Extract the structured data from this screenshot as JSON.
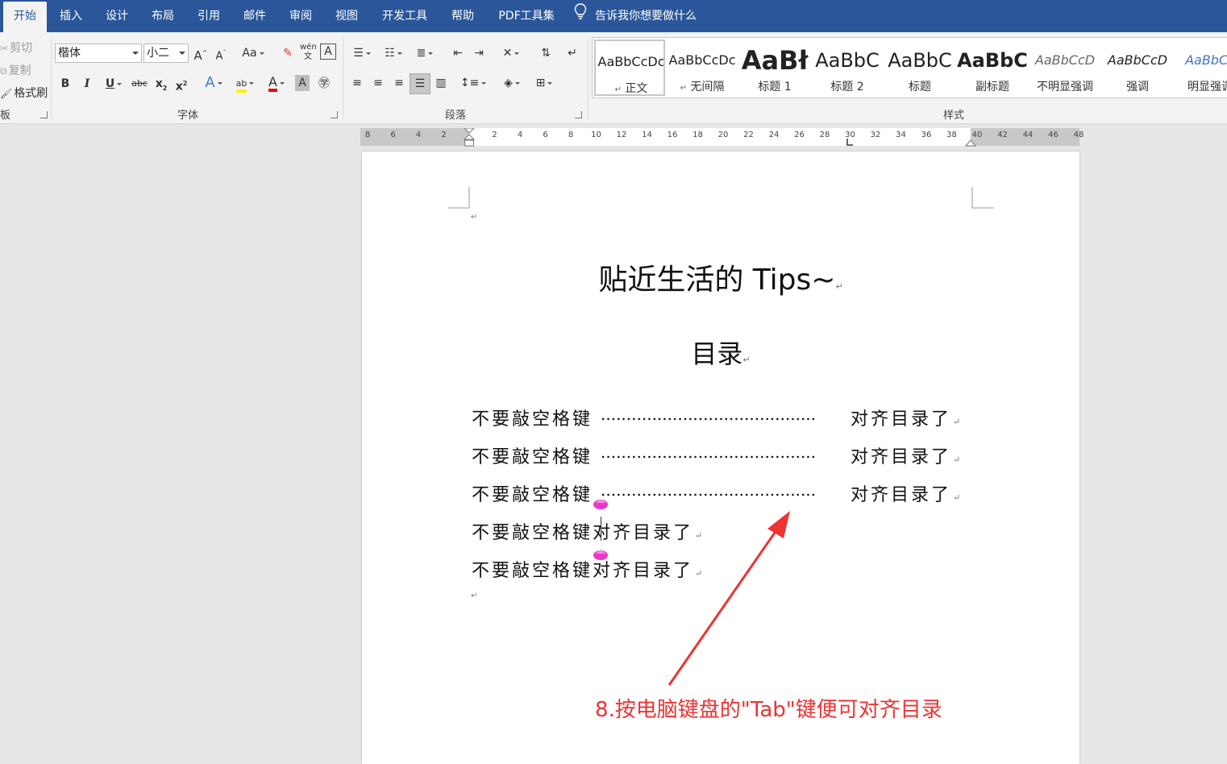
{
  "tabs": [
    {
      "label": "开始",
      "active": true
    },
    {
      "label": "插入"
    },
    {
      "label": "设计"
    },
    {
      "label": "布局"
    },
    {
      "label": "引用"
    },
    {
      "label": "邮件"
    },
    {
      "label": "审阅"
    },
    {
      "label": "视图"
    },
    {
      "label": "开发工具"
    },
    {
      "label": "帮助"
    },
    {
      "label": "PDF工具集"
    }
  ],
  "tell_me": "告诉我你想要做什么",
  "clipboard": {
    "cut": "剪切",
    "copy": "复制",
    "format_painter": "格式刷",
    "group_label": "板"
  },
  "font": {
    "name": "楷体",
    "size": "小二",
    "grow": "A",
    "shrink": "A",
    "change_case": "Aa",
    "bold": "B",
    "italic": "I",
    "underline": "U",
    "strikethrough": "abc",
    "subscript": "x",
    "superscript": "x",
    "group_label": "字体"
  },
  "paragraph": {
    "group_label": "段落"
  },
  "styles": {
    "group_label": "样式",
    "items": [
      {
        "preview": "AaBbCcDc",
        "name": "正文"
      },
      {
        "preview": "AaBbCcDc",
        "name": "无间隔"
      },
      {
        "preview": "AaBł",
        "name": "标题 1"
      },
      {
        "preview": "AaBbC",
        "name": "标题 2"
      },
      {
        "preview": "AaBbC",
        "name": "标题"
      },
      {
        "preview": "AaBbC",
        "name": "副标题"
      },
      {
        "preview": "AaBbCcD",
        "name": "不明显强调"
      },
      {
        "preview": "AaBbCcD",
        "name": "强调"
      },
      {
        "preview": "AaBbCc",
        "name": "明显强调"
      }
    ]
  },
  "ruler": {
    "numbers": [
      "8",
      "6",
      "4",
      "2",
      "2",
      "4",
      "6",
      "8",
      "10",
      "12",
      "14",
      "16",
      "18",
      "20",
      "22",
      "24",
      "26",
      "28",
      "30",
      "32",
      "34",
      "36",
      "38",
      "40",
      "42",
      "44",
      "46",
      "48"
    ]
  },
  "document": {
    "title": "贴近生活的 Tips~",
    "heading": "目录",
    "toc_rows": [
      {
        "left": "不要敲空格键",
        "dots": "..........................................",
        "right": "对齐目录了"
      },
      {
        "left": "不要敲空格键",
        "dots": "..........................................",
        "right": "对齐目录了"
      },
      {
        "left": "不要敲空格键",
        "dots": "..........................................",
        "right": "对齐目录了"
      }
    ],
    "plain_rows": [
      {
        "left": "不要敲空格键",
        "right": "对齐目录了"
      },
      {
        "left": "不要敲空格键",
        "right": "对齐目录了"
      }
    ],
    "para_mark": "↵"
  },
  "annotation": "8.按电脑键盘的\"Tab\"键便可对齐目录",
  "colors": {
    "tab_bar": "#2b579a",
    "annotation": "#ee3333",
    "marker": "#e838c8"
  }
}
